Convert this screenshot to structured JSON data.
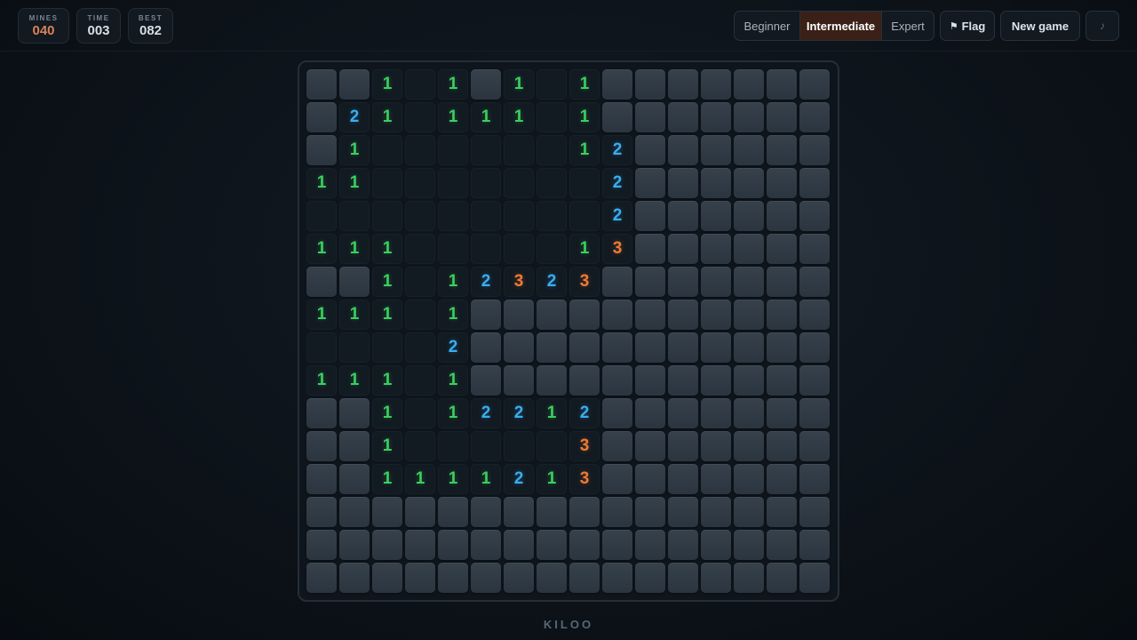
{
  "stats": {
    "mines": {
      "label": "MINES",
      "value": "040"
    },
    "time": {
      "label": "TIME",
      "value": "003"
    },
    "best": {
      "label": "BEST",
      "value": "082"
    }
  },
  "difficulty": {
    "options": [
      "Beginner",
      "Intermediate",
      "Expert"
    ],
    "selected": "Intermediate"
  },
  "toolbar": {
    "flag_label": "Flag",
    "flag_icon": "⚑",
    "new_game_label": "New game",
    "sound_icon": "♪"
  },
  "colors": {
    "one": "#3ccf5e",
    "two": "#38aef0",
    "three": "#f07a32",
    "accent": "#3a2016"
  },
  "board": {
    "rows": 16,
    "cols": 16,
    "cells": [
      "HH1.1H1.1HHHHHHH",
      "H21.111.1HHHHHHH",
      "H1......12HHHHHH",
      "11.......2HHHHHH",
      ".........2HHHHHH",
      "111.....13HHHHHH",
      "HH1.12323HHHHHHH",
      "111.1HHHHHHHHHHH",
      "....2HHHHHHHHHHH",
      "111.1HHHHHHHHHHH",
      "HH1.12212HHHHHHH",
      "HH1.....3HHHHHHH",
      "HH1111213HHHHHHH",
      "HHHHHHHHHHHHHHHH",
      "HHHHHHHHHHHHHHHH",
      "HHHHHHHHHHHHHHHH"
    ]
  },
  "footer": {
    "brand": "KILOO"
  }
}
